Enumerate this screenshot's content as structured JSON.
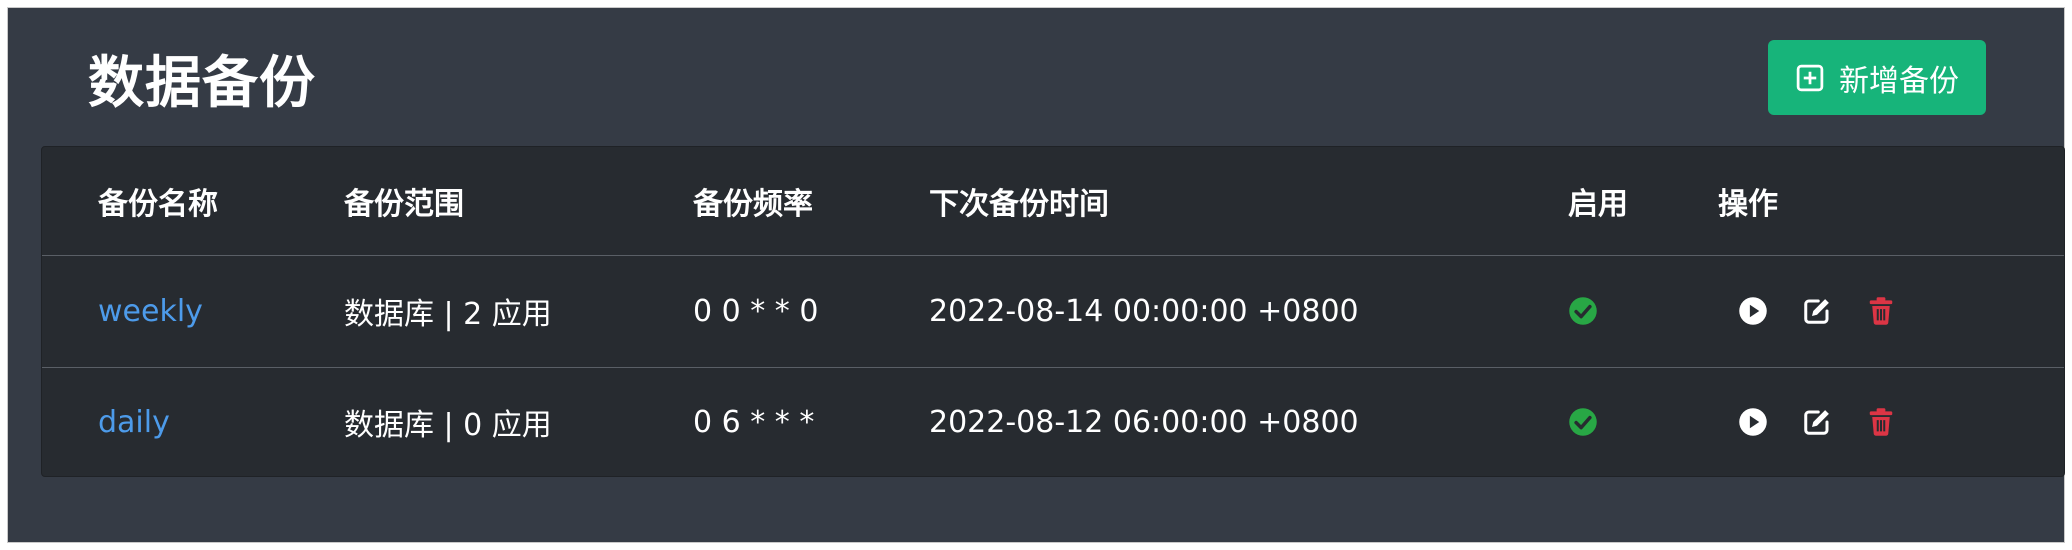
{
  "header": {
    "title": "数据备份",
    "add_button_label": "新增备份"
  },
  "table": {
    "columns": [
      "备份名称",
      "备份范围",
      "备份频率",
      "下次备份时间",
      "启用",
      "操作"
    ],
    "rows": [
      {
        "name": "weekly",
        "scope": "数据库 | 2 应用",
        "frequency": "0 0 * * 0",
        "next_time": "2022-08-14 00:00:00 +0800",
        "enabled": true
      },
      {
        "name": "daily",
        "scope": "数据库 | 0 应用",
        "frequency": "0 6 * * *",
        "next_time": "2022-08-12 06:00:00 +0800",
        "enabled": true
      }
    ]
  },
  "icons": {
    "add": "plus-square-icon",
    "enabled": "check-circle-icon",
    "run": "play-circle-icon",
    "edit": "edit-icon",
    "delete": "trash-icon"
  },
  "colors": {
    "page_background": "#353b45",
    "table_background": "#272b30",
    "accent_button": "#17b47a",
    "link": "#4d9bea",
    "enabled_check": "#28a745",
    "delete_icon": "#dc3545"
  }
}
